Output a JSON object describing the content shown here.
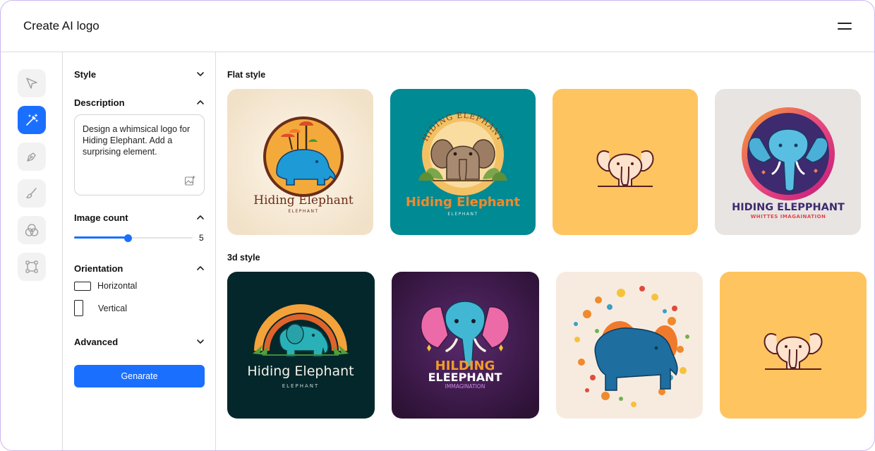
{
  "header": {
    "title": "Create AI logo"
  },
  "panel": {
    "style_label": "Style",
    "description_label": "Description",
    "description_text": "Design a whimsical logo for Hiding Elephant. Add a surprising element.",
    "image_count_label": "Image count",
    "image_count_value": 5,
    "image_count_value_text": "5",
    "image_count_fraction": 0.45,
    "orientation_label": "Orientation",
    "orientation_options": [
      "Horizontal",
      "Vertical"
    ],
    "advanced_label": "Advanced",
    "generate_label": "Genarate"
  },
  "gallery": {
    "flat_label": "Flat style",
    "threed_label": "3d style",
    "flat_cards": [
      {
        "text": "Hiding Elephant",
        "subtext": "ELEPHANT",
        "bg": "#f5ecdc"
      },
      {
        "text": "Hiding Elephant",
        "arc_text": "HIDING ELEPHANT",
        "subtext": "ELEPHANT",
        "bg": "#008a94"
      },
      {
        "text": "",
        "bg": "#fec45f"
      },
      {
        "text": "HIDING ELEPPHANT",
        "subtext": "WHITTES IMAGAINATION",
        "bg": "#e8e4e2"
      }
    ],
    "threed_cards": [
      {
        "text": "Hiding Elephant",
        "subtext": "ELEPHANT",
        "bg": "#03272a"
      },
      {
        "text": "HILDING",
        "text2": "ELEEPHANT",
        "subtext": "IMMAGINATION",
        "bg": "#3a1a45"
      },
      {
        "text": "",
        "bg": "#f7ebe0"
      },
      {
        "text": "",
        "bg": "#fec45f"
      }
    ]
  },
  "colors": {
    "accent": "#1a6fff",
    "border": "#dcdcdc"
  },
  "icons": [
    "pointer-icon",
    "magic-wand-icon",
    "pen-tool-icon",
    "brush-icon",
    "circles-icon",
    "frame-icon",
    "menu-icon",
    "chevron-down-icon",
    "chevron-up-icon",
    "image-add-icon"
  ]
}
